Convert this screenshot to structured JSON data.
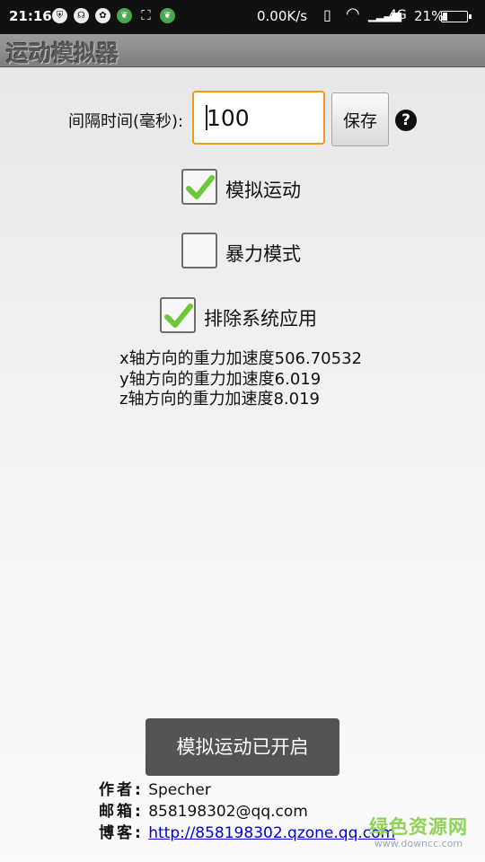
{
  "status_bar": {
    "time": "21:16",
    "net_speed": "0.00K/s",
    "network_type": "4G",
    "battery_percent": "21%",
    "battery_level": 0.21,
    "icons": [
      "shield-icon",
      "headset-icon",
      "app-icon",
      "leaf-icon",
      "scan-icon",
      "leaf-icon",
      "vibrate-icon",
      "wifi-icon",
      "signal-icon",
      "battery-icon"
    ]
  },
  "app": {
    "title": "运动模拟器"
  },
  "interval": {
    "label": "间隔时间(毫秒):",
    "value": "100",
    "save_label": "保存",
    "help_icon": "?"
  },
  "options": [
    {
      "label": "模拟运动",
      "checked": true
    },
    {
      "label": "暴力模式",
      "checked": false
    },
    {
      "label": "排除系统应用",
      "checked": true
    }
  ],
  "gravity": {
    "x": "x轴方向的重力加速度506.70532",
    "y": "y轴方向的重力加速度6.019",
    "z": "z轴方向的重力加速度8.019"
  },
  "toast": "模拟运动已开启",
  "info": {
    "author_label": "作者:",
    "author": "Specher",
    "email_label": "邮箱:",
    "email": "858198302@qq.com",
    "blog_label": "博客:",
    "blog": "http://858198302.qzone.qq.com"
  },
  "watermark": {
    "main": "绿色资源网",
    "sub": "www.downcc.com"
  },
  "colors": {
    "input_focus": "#f29a1b",
    "check": "#6fc83a",
    "link": "#0000e0",
    "toast_bg": "#545454"
  }
}
